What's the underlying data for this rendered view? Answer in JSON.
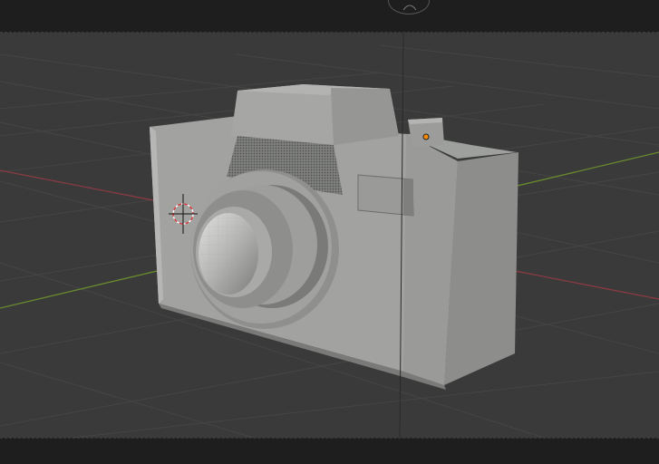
{
  "app": {
    "viewport_mode": "solid",
    "colors": {
      "viewport_bg": "#3a3a3a",
      "grid": "#454545",
      "x_axis": "#8b3a44",
      "y_axis": "#6a8a2e",
      "header_bg": "#1e1e1e",
      "mesh_light": "#a7a8a6",
      "mesh_mid": "#8f908e",
      "mesh_dark": "#6f706e",
      "selection_dot": "#ff8c00"
    }
  },
  "scene": {
    "object": "camera-model",
    "cursor": "3d-cursor-icon",
    "origin": "object-origin-icon"
  }
}
